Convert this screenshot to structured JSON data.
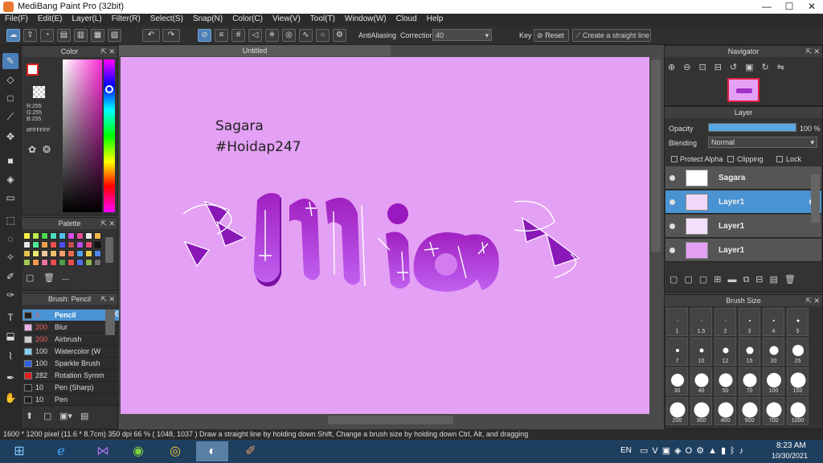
{
  "window": {
    "title": "MediBang Paint Pro (32bit)",
    "min": "—",
    "max": "☐",
    "close": "✕"
  },
  "menu": [
    "File(F)",
    "Edit(E)",
    "Layer(L)",
    "Filter(R)",
    "Select(S)",
    "Snap(N)",
    "Color(C)",
    "View(V)",
    "Tool(T)",
    "Window(W)",
    "Cloud",
    "Help"
  ],
  "toolbar": {
    "antialiasing": "AntiAliasing",
    "correction_label": "Correction",
    "correction_value": "40",
    "key_label": "Key",
    "reset_label": "Reset",
    "straight_line": "Create a straight line"
  },
  "color_panel": {
    "title": "Color",
    "r": "R:255",
    "g": "G:255",
    "b": "B:255",
    "hex": "#FFFFFF",
    "fg": "#ffffff"
  },
  "palette_panel": {
    "title": "Palette",
    "dash": "---",
    "colors": [
      "#f7f04a",
      "#bfea4e",
      "#4ed84e",
      "#4ed8c0",
      "#4ec0ea",
      "#d84eea",
      "#ea4e9a",
      "#e8e8e8",
      "#f5b84e",
      "#e6e6e6",
      "#4eea9a",
      "#eaa04e",
      "#ea4e4e",
      "#4e4eea",
      "#c04e4e",
      "#b84eea",
      "#ea4e70",
      "#111111",
      "#e8c04e",
      "#e8e870",
      "#f0c8a0",
      "#eac06a",
      "#f0a070",
      "#e86a4e",
      "#4ea0ea",
      "#eacc4e",
      "#4e88ea",
      "#a0c84e",
      "#f09a4e",
      "#ea70a0",
      "#ea4e4e",
      "#4ea04e",
      "#e84e4e",
      "#4e70ea",
      "#8ab84e",
      "#707070"
    ]
  },
  "brush_panel": {
    "title": "Brush: Pencil",
    "items": [
      {
        "size": "4",
        "name": "Pencil",
        "color": "#222222"
      },
      {
        "size": "200",
        "name": "Blur",
        "color": "#e9b0e8"
      },
      {
        "size": "200",
        "name": "Airbrush",
        "color": "#d0d0d0"
      },
      {
        "size": "100",
        "name": "Watercolor (W",
        "color": "#7fd0f0"
      },
      {
        "size": "100",
        "name": "Sparkle Brush",
        "color": "#3060e0"
      },
      {
        "size": "282",
        "name": "Rotation Symm",
        "color": "#e02020"
      },
      {
        "size": "10",
        "name": "Pen (Sharp)",
        "color": "#222222"
      },
      {
        "size": "10",
        "name": "Pen",
        "color": "#222222"
      }
    ]
  },
  "canvas": {
    "tab": "Untitled",
    "text1": "Sagara",
    "text2": "#Hoidap247",
    "bg": "#e4a0f4"
  },
  "navigator": {
    "title": "Navigator"
  },
  "layer_panel": {
    "title": "Layer",
    "opacity_label": "Opacity",
    "opacity_value": "100 %",
    "opacity_fraction": 1.0,
    "blending_label": "Blending",
    "blending_value": "Normal",
    "protect_alpha": "Protect Alpha",
    "clipping": "Clipping",
    "lock": "Lock",
    "layers": [
      {
        "name": "Sagara"
      },
      {
        "name": "Layer1"
      },
      {
        "name": "Layer1"
      },
      {
        "name": "Layer1"
      }
    ]
  },
  "brush_size": {
    "title": "Brush Size",
    "sizes": [
      "1",
      "1.5",
      "2",
      "3",
      "4",
      "5",
      "7",
      "10",
      "12",
      "15",
      "20",
      "25",
      "30",
      "40",
      "50",
      "70",
      "100",
      "150",
      "200",
      "300",
      "400",
      "500",
      "700",
      "1000"
    ]
  },
  "status": {
    "text": "1600 * 1200 pixel   (11.6 * 8.7cm)   350 dpi   66 %   ( 1048, 1037 )   Draw a straight line by holding down Shift, Change a brush size by holding down Ctrl, Alt, and dragging"
  },
  "taskbar": {
    "lang": "EN",
    "time": "8:23 AM",
    "date": "10/30/2021"
  }
}
